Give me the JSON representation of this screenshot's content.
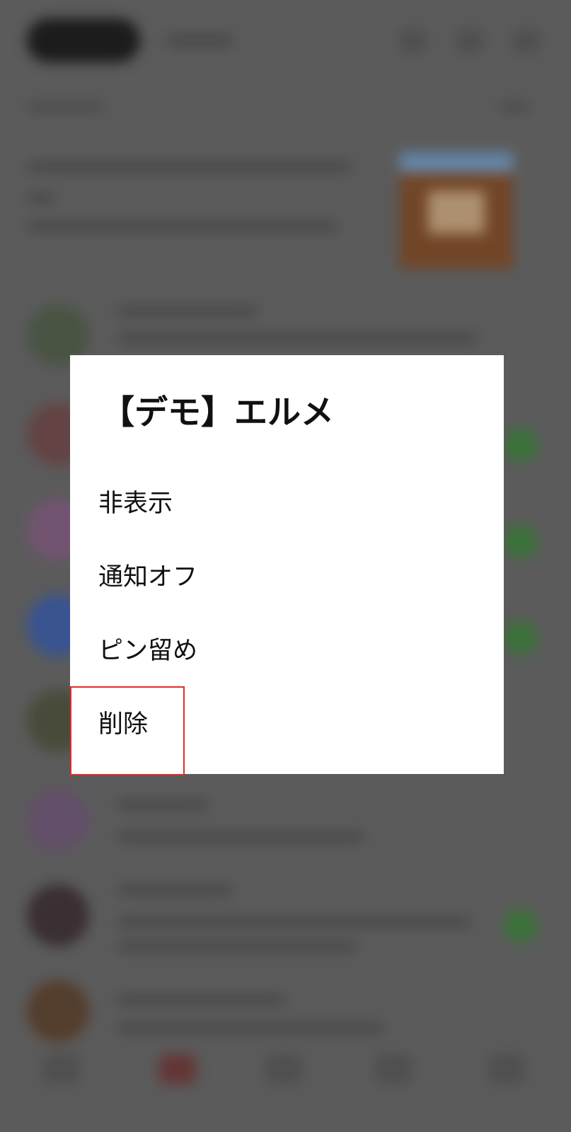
{
  "dialog": {
    "title": "【デモ】エルメ",
    "items": [
      {
        "label": "非表示"
      },
      {
        "label": "通知オフ"
      },
      {
        "label": "ピン留め"
      },
      {
        "label": "削除"
      }
    ]
  },
  "highlight": {
    "target": "削除",
    "color": "#e32b2b"
  },
  "colors": {
    "overlay": "#616161",
    "dialog_background": "#ffffff",
    "badge_green": "#3e7a3c"
  }
}
